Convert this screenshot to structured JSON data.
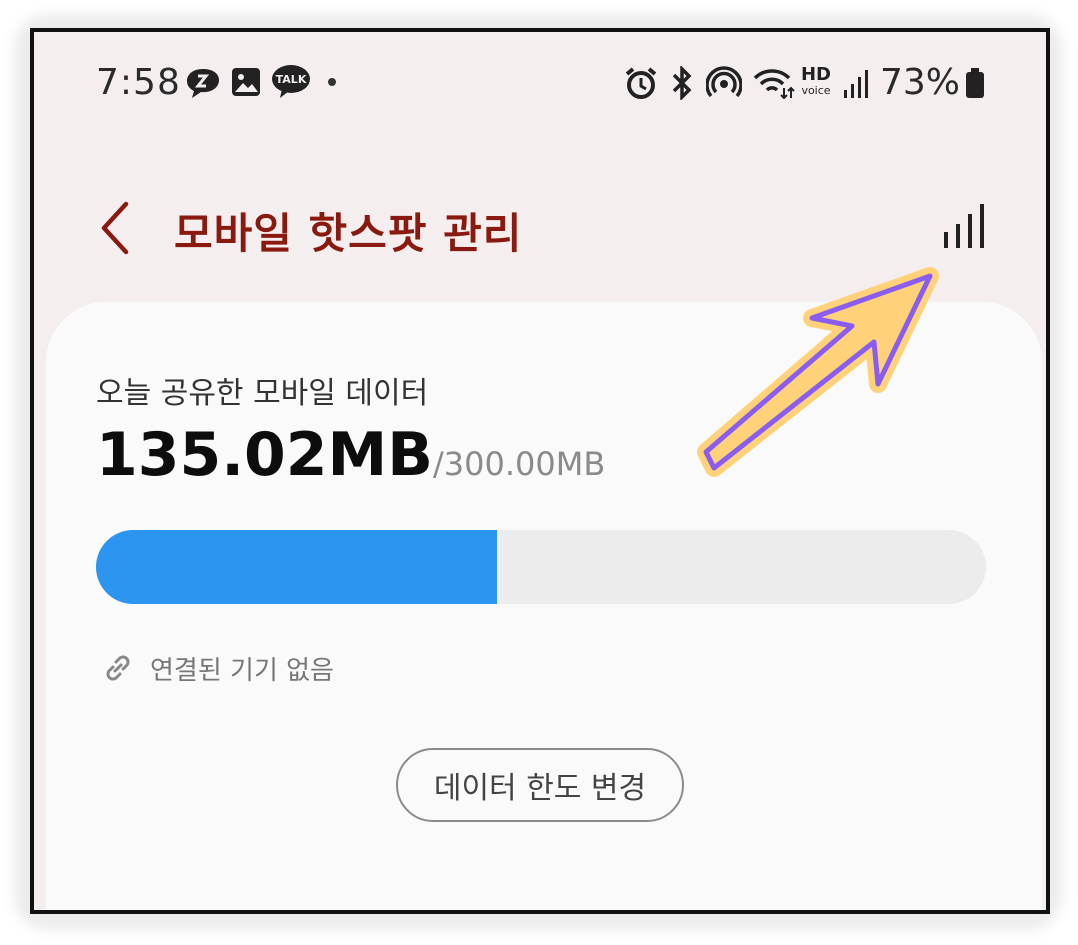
{
  "status_bar": {
    "time": "7:58",
    "notification_icons": [
      "chat-bubble-icon",
      "gallery-icon",
      "kakaotalk-icon",
      "more-dot-icon"
    ],
    "talk_badge": "TALK",
    "system_icons": [
      "alarm-icon",
      "bluetooth-icon",
      "hotspot-icon",
      "wifi-icon",
      "hd-voice-icon",
      "cell-signal-icon",
      "battery-icon"
    ],
    "hd_label": "HD",
    "voice_label": "voice",
    "battery_percent": "73%"
  },
  "appbar": {
    "title": "모바일 핫스팟 관리",
    "title_color": "#8a1a10"
  },
  "data_card": {
    "label": "오늘 공유한 모바일 데이터",
    "used": "135.02MB",
    "separator": "/",
    "limit": "300.00MB",
    "progress_fraction": 0.45,
    "progress_color": "#2b95f0",
    "connected_devices": "연결된 기기 없음",
    "change_limit_button": "데이터 한도 변경"
  },
  "annotation": {
    "arrow_fill": "#ffd27a",
    "arrow_stroke": "#8a5cf0"
  }
}
